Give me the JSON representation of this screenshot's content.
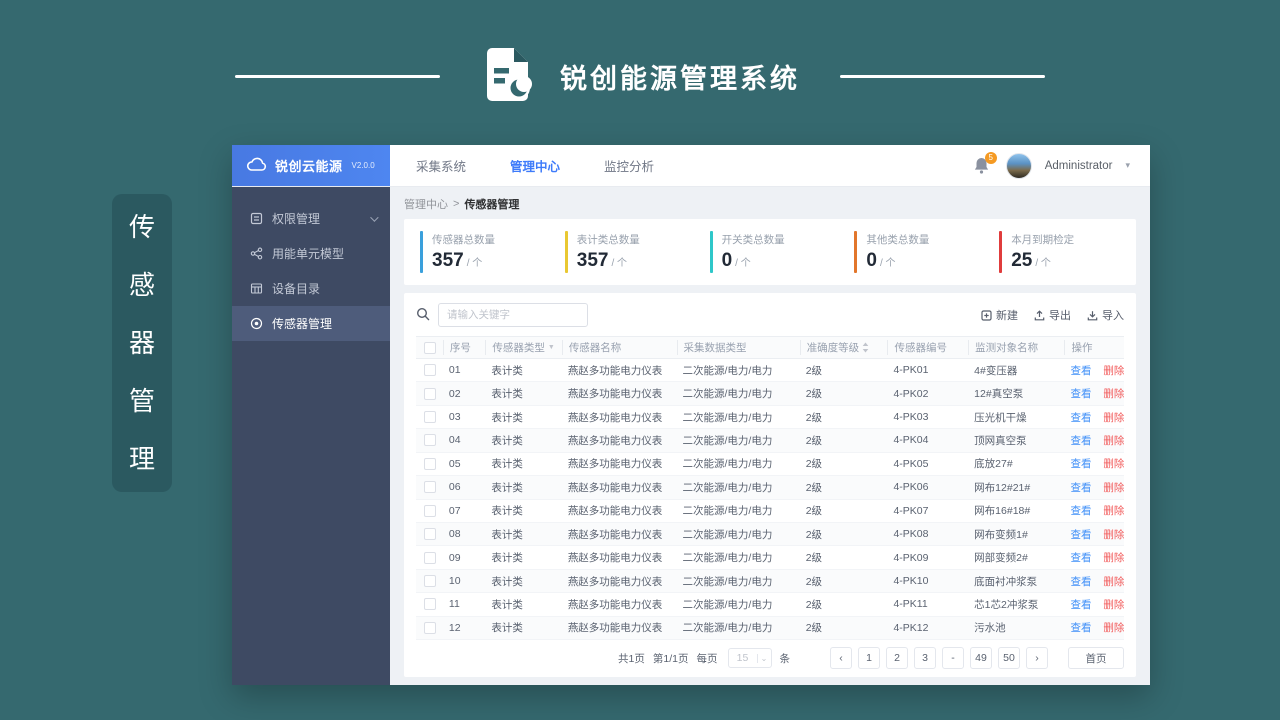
{
  "page": {
    "title": "锐创能源管理系统",
    "side_tag_chars": [
      {
        "ch": "传"
      },
      {
        "ch": "感"
      },
      {
        "ch": "器"
      },
      {
        "ch": "管"
      },
      {
        "ch": "理"
      }
    ]
  },
  "app": {
    "brand": {
      "name": "锐创云能源",
      "version": "V2.0.0"
    },
    "topnav": [
      {
        "label": "采集系统"
      },
      {
        "label": "管理中心"
      },
      {
        "label": "监控分析"
      }
    ],
    "user": {
      "name": "Administrator",
      "notification_badge": "5",
      "caret": "▾"
    },
    "sidebar": [
      {
        "label": "权限管理"
      },
      {
        "label": "用能单元模型"
      },
      {
        "label": "设备目录"
      },
      {
        "label": "传感器管理"
      }
    ],
    "breadcrumb": {
      "parent": "管理中心",
      "separator": ">",
      "current": "传感器管理"
    },
    "stats": [
      {
        "label": "传感器总数量",
        "value": "357",
        "unit": "/ 个",
        "bar_style": "background:#3AA0DC"
      },
      {
        "label": "表计类总数量",
        "value": "357",
        "unit": "/ 个",
        "bar_style": "background:#E9C832"
      },
      {
        "label": "开关类总数量",
        "value": "0",
        "unit": "/ 个",
        "bar_style": "background:#2EC7C9"
      },
      {
        "label": "其他类总数量",
        "value": "0",
        "unit": "/ 个",
        "bar_style": "background:#E2762B"
      },
      {
        "label": "本月到期检定",
        "value": "25",
        "unit": "/ 个",
        "bar_style": "background:#E03C3C"
      }
    ],
    "toolbar": {
      "search_placeholder": "请输入关键字",
      "new_label": "新建",
      "export_label": "导出",
      "import_label": "导入"
    },
    "table": {
      "columns": {
        "no": "序号",
        "type": "传感器类型",
        "name": "传感器名称",
        "data_type": "采集数据类型",
        "accuracy": "准确度等级",
        "code": "传感器编号",
        "target": "监测对象名称",
        "ops": "操作"
      },
      "filter_glyph": "▼",
      "view_label": "查看",
      "delete_label": "删除",
      "rows": [
        {
          "no": "01",
          "type": "表计类",
          "name": "燕赵多功能电力仪表",
          "data_type": "二次能源/电力/电力",
          "accuracy": "2级",
          "code": "4-PK01",
          "target": "4#变压器"
        },
        {
          "no": "02",
          "type": "表计类",
          "name": "燕赵多功能电力仪表",
          "data_type": "二次能源/电力/电力",
          "accuracy": "2级",
          "code": "4-PK02",
          "target": "12#真空泵"
        },
        {
          "no": "03",
          "type": "表计类",
          "name": "燕赵多功能电力仪表",
          "data_type": "二次能源/电力/电力",
          "accuracy": "2级",
          "code": "4-PK03",
          "target": "压光机干燥"
        },
        {
          "no": "04",
          "type": "表计类",
          "name": "燕赵多功能电力仪表",
          "data_type": "二次能源/电力/电力",
          "accuracy": "2级",
          "code": "4-PK04",
          "target": "顶网真空泵"
        },
        {
          "no": "05",
          "type": "表计类",
          "name": "燕赵多功能电力仪表",
          "data_type": "二次能源/电力/电力",
          "accuracy": "2级",
          "code": "4-PK05",
          "target": "底放27#"
        },
        {
          "no": "06",
          "type": "表计类",
          "name": "燕赵多功能电力仪表",
          "data_type": "二次能源/电力/电力",
          "accuracy": "2级",
          "code": "4-PK06",
          "target": "网布12#21#"
        },
        {
          "no": "07",
          "type": "表计类",
          "name": "燕赵多功能电力仪表",
          "data_type": "二次能源/电力/电力",
          "accuracy": "2级",
          "code": "4-PK07",
          "target": "网布16#18#"
        },
        {
          "no": "08",
          "type": "表计类",
          "name": "燕赵多功能电力仪表",
          "data_type": "二次能源/电力/电力",
          "accuracy": "2级",
          "code": "4-PK08",
          "target": "网布变频1#"
        },
        {
          "no": "09",
          "type": "表计类",
          "name": "燕赵多功能电力仪表",
          "data_type": "二次能源/电力/电力",
          "accuracy": "2级",
          "code": "4-PK09",
          "target": "网部变频2#"
        },
        {
          "no": "10",
          "type": "表计类",
          "name": "燕赵多功能电力仪表",
          "data_type": "二次能源/电力/电力",
          "accuracy": "2级",
          "code": "4-PK10",
          "target": "底面衬冲浆泵"
        },
        {
          "no": "11",
          "type": "表计类",
          "name": "燕赵多功能电力仪表",
          "data_type": "二次能源/电力/电力",
          "accuracy": "2级",
          "code": "4-PK11",
          "target": "芯1芯2冲浆泵"
        },
        {
          "no": "12",
          "type": "表计类",
          "name": "燕赵多功能电力仪表",
          "data_type": "二次能源/电力/电力",
          "accuracy": "2级",
          "code": "4-PK12",
          "target": "污水池"
        }
      ]
    },
    "pagination": {
      "total_pages": "共1页",
      "current_page": "第1/1页",
      "per_page_label": "每页",
      "per_page_value": "15",
      "per_page_caret": "⌄",
      "unit_label": "条",
      "prev": "‹",
      "next": "›",
      "pages": [
        {
          "label": "1"
        },
        {
          "label": "2"
        },
        {
          "label": "3"
        },
        {
          "label": "-"
        },
        {
          "label": "49"
        },
        {
          "label": "50"
        }
      ],
      "home_label": "首页"
    }
  }
}
